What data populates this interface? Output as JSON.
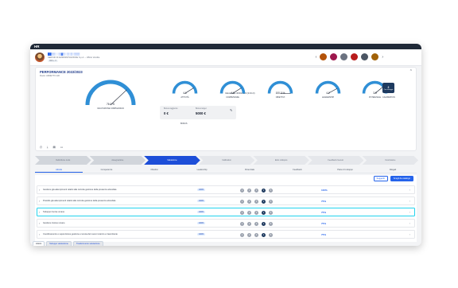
{
  "app": {
    "logo": "HR"
  },
  "user": {
    "name": "██▒▒░ ░▒▓▒░ ▒░▒░▒▒▒",
    "role": "SERVIZI DI AMMINISTRAZIONE S.p.A. – Ufficio Vendite",
    "tag": "000 + 3"
  },
  "peers": [
    {
      "name": "peer-1",
      "color": "#b45309"
    },
    {
      "name": "peer-2",
      "color": "#9d174d"
    },
    {
      "name": "peer-3",
      "color": "#6b7280"
    },
    {
      "name": "peer-4",
      "color": "#b91c1c"
    },
    {
      "name": "peer-5",
      "color": "#4b5563"
    },
    {
      "name": "peer-6",
      "color": "#a16207"
    }
  ],
  "panel": {
    "title": "PERFORMANCE 2022/2023",
    "subtitle": "Ruolo: ADDETTO HR",
    "collapse_icon": "chevron-up-icon",
    "date_label": "Valutazione 30/03/2023 (3.0/4.0)"
  },
  "gauges": [
    {
      "key": "overall",
      "value": 76.0,
      "display": "76.0 %",
      "label": "VALUTAZIONE COMPLESSIVA"
    },
    {
      "key": "attivita",
      "value": 4.1,
      "display": "4.1",
      "label": "ATTIVITÀ"
    },
    {
      "key": "competenze",
      "value": 4.1,
      "display": "4.1",
      "label": "COMPETENZE"
    },
    {
      "key": "obiettivi",
      "value": 100.0,
      "display": "100.0 %",
      "label": "OBIETTIVI"
    },
    {
      "key": "leadership",
      "value": 4.2,
      "display": "4.2",
      "label": "LEADERSHIP"
    },
    {
      "key": "potenziale",
      "value": 3.9,
      "display": "3.9",
      "label": "POTENZIALE"
    }
  ],
  "bonus": {
    "col1_label": "Bonus raggiunto",
    "col1_value": "0 €",
    "col2_label": "Bonus target",
    "col2_value": "5000 €",
    "label": "BONUS"
  },
  "calibration": {
    "value": "2",
    "sub": "Con vantaggio",
    "label": "CALIBRATION"
  },
  "steps": [
    {
      "label": "Definizione ruolo",
      "state": "done"
    },
    {
      "label": "Assegnazione",
      "state": "done"
    },
    {
      "label": "Valutazione",
      "state": "active"
    },
    {
      "label": "Calibration",
      "state": ""
    },
    {
      "label": "Esito colloquio",
      "state": ""
    },
    {
      "label": "Feedback ricevuto",
      "state": ""
    },
    {
      "label": "Conclusione",
      "state": ""
    }
  ],
  "tabs": [
    "Attività",
    "Competenze",
    "Obiettivi",
    "Leadership",
    "Potenziale",
    "Feedback",
    "Piano di sviluppo",
    "Allegati"
  ],
  "actions": {
    "suggest": "Suggeriti",
    "add": "Scegli da catalogo"
  },
  "rows": [
    {
      "name": "Gestione già adempimenti relativi alla corretta gestione della presenza aziendale",
      "pct": "100%",
      "selected": 4,
      "score": "100%"
    },
    {
      "name": "Presidio già adempimenti relativi alla corretta gestione della presenza aziendale",
      "pct": "100%",
      "selected": 4,
      "score": "75%"
    },
    {
      "name": "Sviluppo risorse umane",
      "pct": "100%",
      "selected": 4,
      "score": "75%"
    },
    {
      "name": "Gestione risorse umane",
      "pct": "100%",
      "selected": 4,
      "score": "75%"
    },
    {
      "name": "Coordinamento e supervisione gestione e tenuta del nuovo incarico e trasmittente",
      "pct": "100%",
      "selected": 4,
      "score": "75%"
    }
  ],
  "bottom_tabs": [
    "Azioni",
    "Sviluppo valutazione",
    "Trasferimento valutazione"
  ]
}
